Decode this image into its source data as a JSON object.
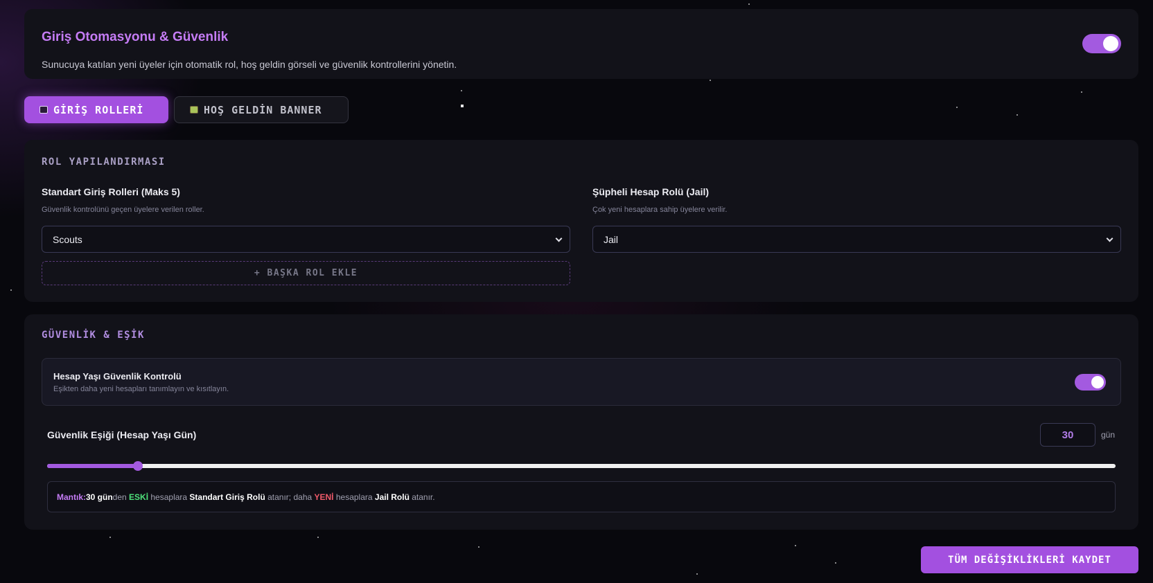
{
  "header": {
    "title": "Giriş Otomasyonu & Güvenlik",
    "description": "Sunucuya katılan yeni üyeler için otomatik rol, hoş geldin görseli ve güvenlik kontrollerini yönetin.",
    "enabled": true
  },
  "tabs": [
    {
      "label": "GİRİŞ ROLLERİ",
      "icon": "user-icon",
      "active": true
    },
    {
      "label": "HOŞ GELDİN BANNER",
      "icon": "image-icon",
      "active": false
    }
  ],
  "roles_section": {
    "title": "ROL YAPILANDIRMASI",
    "standard": {
      "label": "Standart Giriş Rolleri (Maks 5)",
      "help": "Güvenlik kontrolünü geçen üyelere verilen roller.",
      "selected": "Scouts"
    },
    "add_role_label": "+ BAŞKA ROL EKLE",
    "suspicious": {
      "label": "Şüpheli Hesap Rolü (Jail)",
      "help": "Çok yeni hesaplara sahip üyelere verilir.",
      "selected": "Jail"
    }
  },
  "security_section": {
    "title": "GÜVENLİK & EŞİK",
    "age_check": {
      "title": "Hesap Yaşı Güvenlik Kontrolü",
      "description": "Eşikten daha yeni hesapları tanımlayın ve kısıtlayın.",
      "enabled": true
    },
    "threshold": {
      "label": "Güvenlik Eşiği (Hesap Yaşı Gün)",
      "value": "30",
      "unit": "gün",
      "slider_fraction": 0.085
    },
    "logic": {
      "prefix": "Mantık:",
      "days": "30 gün",
      "suffix_den": "den ",
      "old": "ESKİ",
      "to_old": " hesaplara ",
      "standard_role": "Standart Giriş Rolü",
      "assigned_more": " atanır; daha ",
      "new": "YENİ",
      "to_new": " hesaplara ",
      "jail_role": "Jail Rolü",
      "assigned_end": " atanır."
    }
  },
  "save_button": "TÜM DEĞİŞİKLİKLERİ KAYDET",
  "colors": {
    "accent": "#a350e0",
    "accent_text": "#c57cf5",
    "old_green": "#4ee07a",
    "new_red": "#f05a6a",
    "background": "#08080d",
    "card": "#121219"
  }
}
